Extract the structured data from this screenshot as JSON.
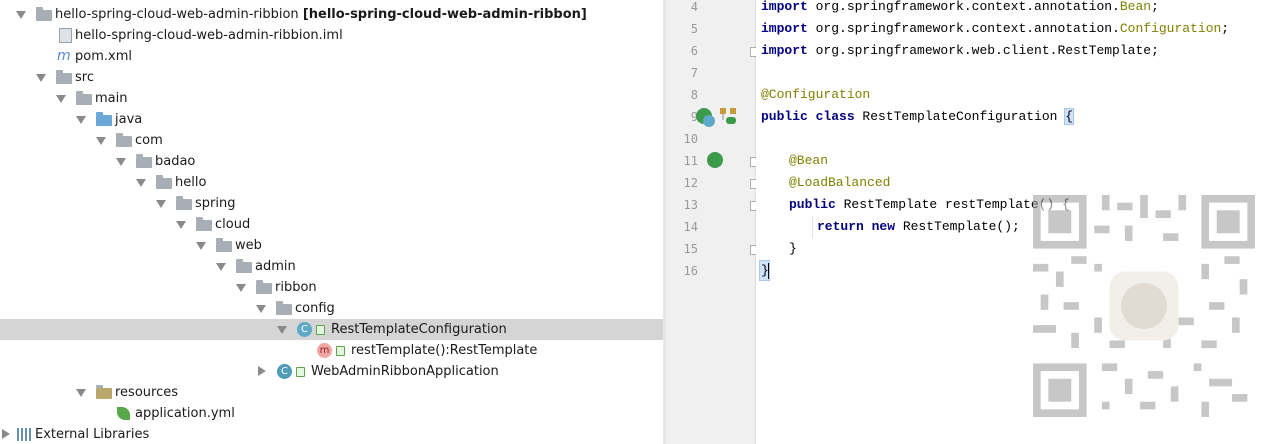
{
  "project_tree": {
    "root": {
      "name": "hello-spring-cloud-web-admin-ribbion",
      "module": "[hello-spring-cloud-web-admin-ribbon]"
    },
    "iml_file": "hello-spring-cloud-web-admin-ribbion.iml",
    "pom_file": "pom.xml",
    "src": "src",
    "main": "main",
    "java": "java",
    "packages": [
      "com",
      "badao",
      "hello",
      "spring",
      "cloud",
      "web",
      "admin",
      "ribbon",
      "config"
    ],
    "class_file": "RestTemplateConfiguration",
    "class_badge": "C",
    "method": "restTemplate():RestTemplate",
    "method_badge": "m",
    "app_class": "WebAdminRibbonApplication",
    "resources": "resources",
    "yml_file": "application.yml",
    "external_libraries": "External Libraries"
  },
  "editor": {
    "line_numbers": [
      "4",
      "5",
      "6",
      "7",
      "8",
      "9",
      "10",
      "11",
      "12",
      "13",
      "14",
      "15",
      "16"
    ],
    "code": {
      "l4": {
        "kw": "import",
        "pre": " org.springframework.context.annotation.",
        "cls": "Bean",
        "post": ";"
      },
      "l5": {
        "kw": "import",
        "pre": " org.springframework.context.annotation.",
        "cls": "Configuration",
        "post": ";"
      },
      "l6": {
        "kw": "import",
        "pre": " org.springframework.web.client.RestTemplate;"
      },
      "l8": {
        "ann": "@Configuration"
      },
      "l9": {
        "kw": "public class",
        "pre": " RestTemplateConfiguration ",
        "brace": "{"
      },
      "l11": {
        "ann": "@Bean"
      },
      "l12": {
        "ann": "@LoadBalanced"
      },
      "l13": {
        "kw": "public",
        "pre": " RestTemplate restTemplate() {"
      },
      "l14": {
        "kw": "return new",
        "pre": " RestTemplate();"
      },
      "l15": {
        "pre": "}"
      },
      "l16": {
        "pre": "}"
      }
    }
  },
  "colors": {
    "keyword": "#000080",
    "annotation": "#808000",
    "selection": "#d5d5d5",
    "current_line": "#fefbe3"
  }
}
